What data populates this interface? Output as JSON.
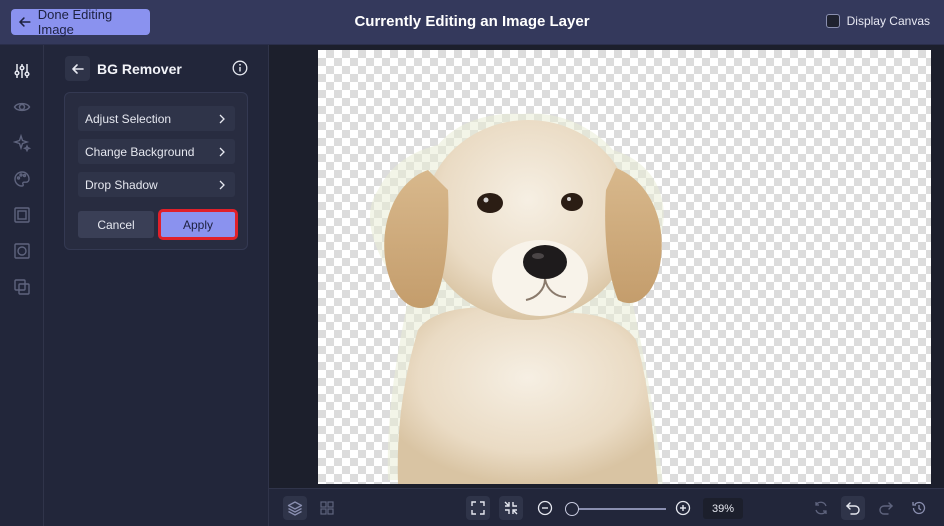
{
  "topbar": {
    "done_label": "Done Editing Image",
    "title": "Currently Editing an Image Layer",
    "display_canvas_label": "Display Canvas",
    "display_canvas_checked": false
  },
  "rail": {
    "icons": [
      "sliders-icon",
      "eye-icon",
      "sparkles-icon",
      "palette-icon",
      "frame-icon",
      "mask-icon",
      "layers-overlap-icon"
    ],
    "active": "sliders-icon"
  },
  "panel": {
    "title": "BG Remover",
    "items": [
      {
        "label": "Adjust Selection"
      },
      {
        "label": "Change Background"
      },
      {
        "label": "Drop Shadow"
      }
    ],
    "cancel_label": "Cancel",
    "apply_label": "Apply"
  },
  "canvas": {
    "subject": "puppy",
    "background": "transparent-checkerboard"
  },
  "bottombar": {
    "zoom_percent": 39,
    "zoom_label": "39%"
  },
  "colors": {
    "accent": "#8a92ef",
    "topbar": "#34395c",
    "panel": "#22263a",
    "highlight": "#e0202a"
  }
}
